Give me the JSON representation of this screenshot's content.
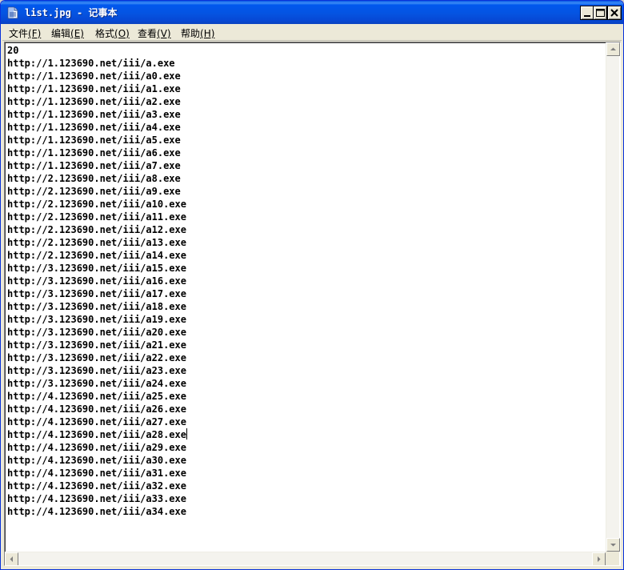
{
  "window": {
    "title": "list.jpg - 记事本",
    "icon": "notepad-icon",
    "controls": {
      "minimize": "minimize-icon",
      "maximize": "maximize-icon",
      "close": "close-icon"
    }
  },
  "menu": [
    {
      "label": "文件",
      "mnemonic": "(F)"
    },
    {
      "label": "编辑",
      "mnemonic": "(E)"
    },
    {
      "label": "格式",
      "mnemonic": "(O)"
    },
    {
      "label": "查看",
      "mnemonic": "(V)"
    },
    {
      "label": "帮助",
      "mnemonic": "(H)"
    }
  ],
  "document": {
    "lines": [
      "20",
      "http://1.123690.net/iii/a.exe",
      "http://1.123690.net/iii/a0.exe",
      "http://1.123690.net/iii/a1.exe",
      "http://1.123690.net/iii/a2.exe",
      "http://1.123690.net/iii/a3.exe",
      "http://1.123690.net/iii/a4.exe",
      "http://1.123690.net/iii/a5.exe",
      "http://1.123690.net/iii/a6.exe",
      "http://1.123690.net/iii/a7.exe",
      "http://2.123690.net/iii/a8.exe",
      "http://2.123690.net/iii/a9.exe",
      "http://2.123690.net/iii/a10.exe",
      "http://2.123690.net/iii/a11.exe",
      "http://2.123690.net/iii/a12.exe",
      "http://2.123690.net/iii/a13.exe",
      "http://2.123690.net/iii/a14.exe",
      "http://3.123690.net/iii/a15.exe",
      "http://3.123690.net/iii/a16.exe",
      "http://3.123690.net/iii/a17.exe",
      "http://3.123690.net/iii/a18.exe",
      "http://3.123690.net/iii/a19.exe",
      "http://3.123690.net/iii/a20.exe",
      "http://3.123690.net/iii/a21.exe",
      "http://3.123690.net/iii/a22.exe",
      "http://3.123690.net/iii/a23.exe",
      "http://3.123690.net/iii/a24.exe",
      "http://4.123690.net/iii/a25.exe",
      "http://4.123690.net/iii/a26.exe",
      "http://4.123690.net/iii/a27.exe",
      "http://4.123690.net/iii/a28.exe",
      "http://4.123690.net/iii/a29.exe",
      "http://4.123690.net/iii/a30.exe",
      "http://4.123690.net/iii/a31.exe",
      "http://4.123690.net/iii/a32.exe",
      "http://4.123690.net/iii/a33.exe",
      "http://4.123690.net/iii/a34.exe"
    ],
    "caret_line": 30
  },
  "scrollbars": {
    "vertical": {
      "up": "arrow-up-icon",
      "down": "arrow-down-icon"
    },
    "horizontal": {
      "left": "arrow-left-icon",
      "right": "arrow-right-icon"
    }
  },
  "colors": {
    "titlebar": "#0554e1",
    "window_bg": "#ece9d8",
    "editor_bg": "#ffffff",
    "text": "#000000"
  }
}
